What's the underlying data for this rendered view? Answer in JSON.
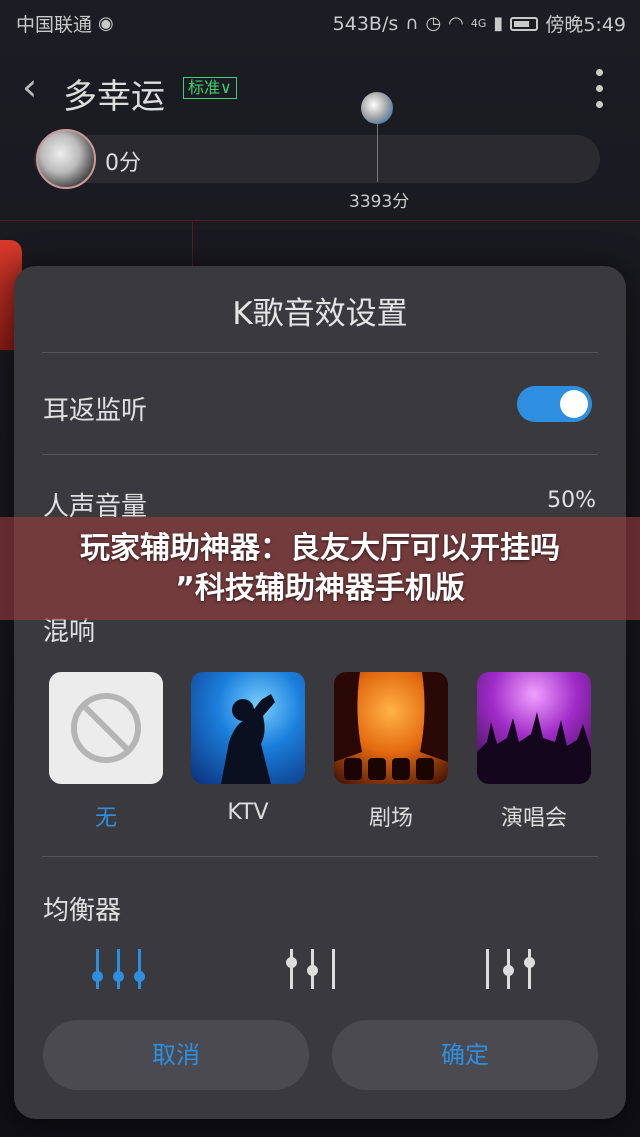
{
  "status_bar": {
    "carrier": "中国联通",
    "speed": "543B/s",
    "network": "4G",
    "time": "傍晚5:49"
  },
  "header": {
    "song_title": "多幸运",
    "quality_label": "标准",
    "my_score": "0分",
    "target_score": "3393分"
  },
  "dialog": {
    "title": "K歌音效设置",
    "monitor_label": "耳返监听",
    "monitor_enabled": true,
    "volume_label": "人声音量",
    "volume_value": "50%",
    "reverb_label": "混响",
    "reverb_options": [
      {
        "label": "无",
        "selected": true
      },
      {
        "label": "KTV",
        "selected": false
      },
      {
        "label": "剧场",
        "selected": false
      },
      {
        "label": "演唱会",
        "selected": false
      }
    ],
    "equalizer_label": "均衡器",
    "cancel_label": "取消",
    "confirm_label": "确定",
    "accent_color": "#2e8fe0"
  },
  "banner": {
    "line1": "玩家辅助神器：良友大厅可以开挂吗",
    "line2": "”科技辅助神器手机版"
  }
}
